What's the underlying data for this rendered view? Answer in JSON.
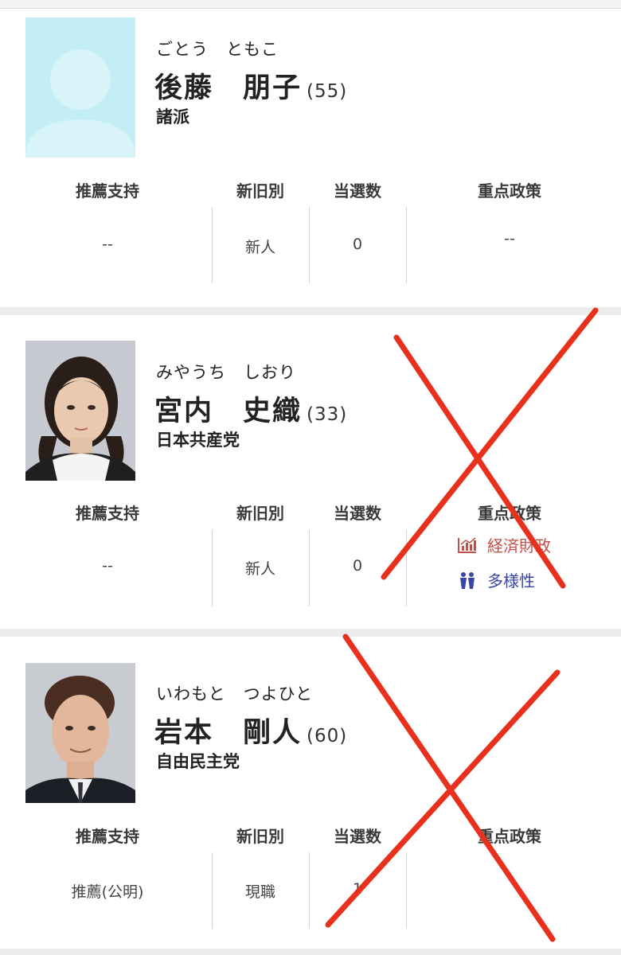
{
  "labels": {
    "support": "推薦支持",
    "type": "新旧別",
    "wins": "当選数",
    "policy": "重点政策"
  },
  "colors": {
    "cross": "#e8311c",
    "policy_economy": "#c0504a",
    "policy_diversity": "#3a45a8",
    "placeholder_bg": "#c3eef5"
  },
  "candidates": [
    {
      "kana": "ごとう　ともこ",
      "name": "後藤　朋子",
      "age": "(55)",
      "party": "諸派",
      "support": "--",
      "type": "新人",
      "wins": "0",
      "policy": "--",
      "photo": "placeholder-avatar-icon",
      "crossed_out": false
    },
    {
      "kana": "みやうち　しおり",
      "name": "宮内　史織",
      "age": "(33)",
      "party": "日本共産党",
      "support": "--",
      "type": "新人",
      "wins": "0",
      "policies": [
        {
          "icon": "bar-chart-icon",
          "label": "経済財政"
        },
        {
          "icon": "people-icon",
          "label": "多様性"
        }
      ],
      "photo": "candidate-photo-woman",
      "crossed_out": true
    },
    {
      "kana": "いわもと　つよひと",
      "name": "岩本　剛人",
      "age": "(60)",
      "party": "自由民主党",
      "support": "推薦(公明)",
      "type": "現職",
      "wins": "1",
      "policy": "",
      "photo": "candidate-photo-man",
      "crossed_out": true
    }
  ]
}
